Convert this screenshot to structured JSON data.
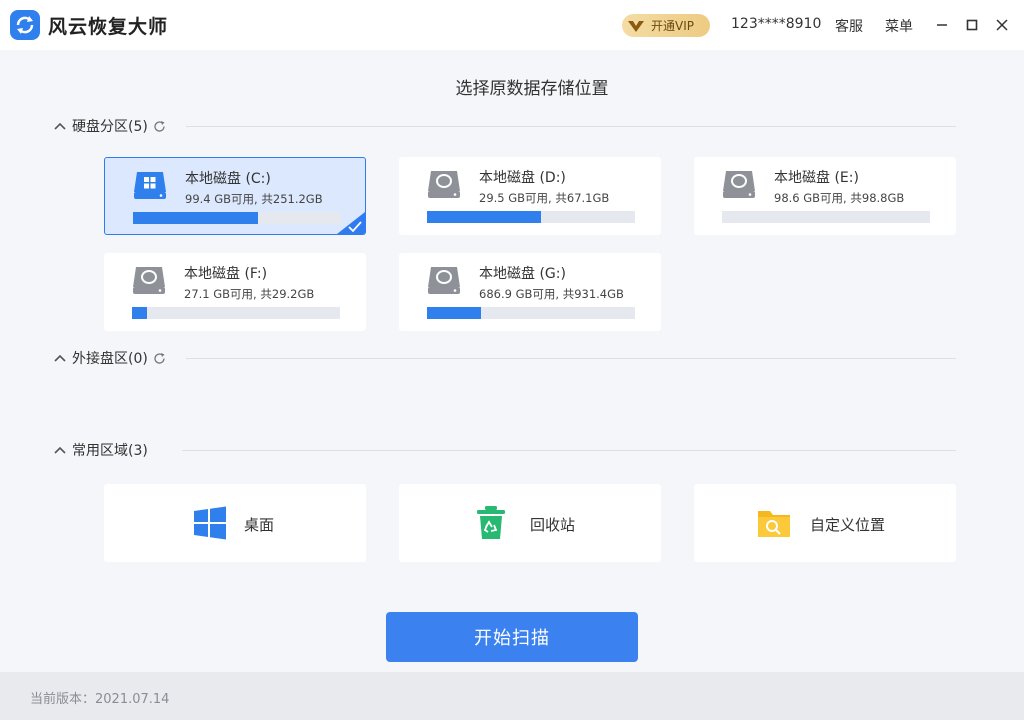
{
  "app": {
    "title": "风云恢复大师",
    "icon": "app-logo-icon",
    "accent_color": "#2f80ed"
  },
  "header": {
    "vip_label": "开通VIP",
    "phone": "123****8910",
    "service_label": "客服",
    "menu_label": "菜单"
  },
  "page_title": "选择原数据存储位置",
  "sections": {
    "disks": {
      "label": "硬盘分区(5)"
    },
    "external": {
      "label": "外接盘区(0)"
    },
    "common": {
      "label": "常用区域(3)"
    }
  },
  "disks": [
    {
      "name": "本地磁盘 (C:)",
      "size_text": "99.4 GB可用, 共251.2GB",
      "used_fraction": 0.6,
      "selected": true,
      "icon": "windows-drive-icon"
    },
    {
      "name": "本地磁盘 (D:)",
      "size_text": "29.5 GB可用, 共67.1GB",
      "used_fraction": 0.55,
      "selected": false,
      "icon": "hard-drive-icon"
    },
    {
      "name": "本地磁盘 (E:)",
      "size_text": "98.6 GB可用, 共98.8GB",
      "used_fraction": 0.0,
      "selected": false,
      "icon": "hard-drive-icon"
    },
    {
      "name": "本地磁盘 (F:)",
      "size_text": "27.1 GB可用, 共29.2GB",
      "used_fraction": 0.07,
      "selected": false,
      "icon": "hard-drive-icon"
    },
    {
      "name": "本地磁盘 (G:)",
      "size_text": "686.9 GB可用, 共931.4GB",
      "used_fraction": 0.26,
      "selected": false,
      "icon": "hard-drive-icon"
    }
  ],
  "common_areas": [
    {
      "label": "桌面",
      "icon": "windows-desktop-icon"
    },
    {
      "label": "回收站",
      "icon": "recycle-bin-icon"
    },
    {
      "label": "自定义位置",
      "icon": "folder-search-icon"
    }
  ],
  "scan_button_label": "开始扫描",
  "footer": {
    "version": "当前版本：2021.07.14"
  }
}
